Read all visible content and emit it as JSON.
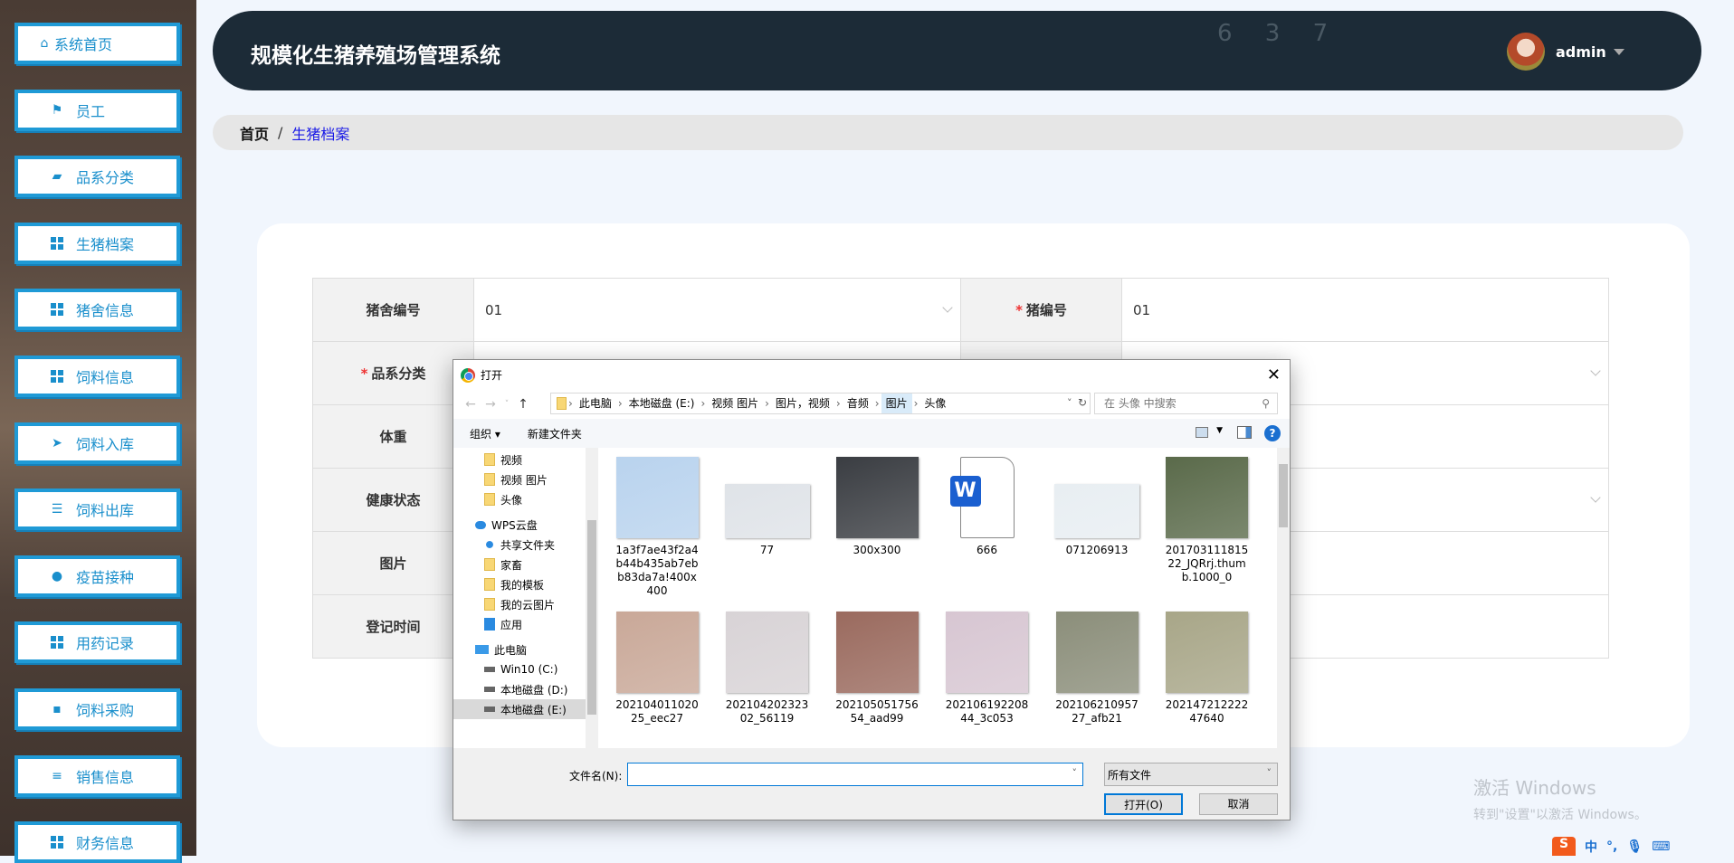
{
  "sidebar": {
    "items": [
      {
        "label": "系统首页",
        "icon": "home-icon"
      },
      {
        "label": "员工",
        "icon": "flag-icon"
      },
      {
        "label": "品系分类",
        "icon": "wallet-icon"
      },
      {
        "label": "生猪档案",
        "icon": "grid-icon"
      },
      {
        "label": "猪舍信息",
        "icon": "grid-icon"
      },
      {
        "label": "饲料信息",
        "icon": "grid-icon"
      },
      {
        "label": "饲料入库",
        "icon": "paper-plane-icon"
      },
      {
        "label": "饲料出库",
        "icon": "sliders-icon"
      },
      {
        "label": "疫苗接种",
        "icon": "bulb-icon"
      },
      {
        "label": "用药记录",
        "icon": "grid-icon"
      },
      {
        "label": "饲料采购",
        "icon": "chat-icon"
      },
      {
        "label": "销售信息",
        "icon": "list-icon"
      },
      {
        "label": "财务信息",
        "icon": "grid-icon"
      }
    ]
  },
  "header": {
    "title": "规模化生猪养殖场管理系统",
    "deco": "6 3 7",
    "user": "admin"
  },
  "breadcrumb": {
    "home": "首页",
    "sep": "/",
    "current": "生猪档案"
  },
  "form": {
    "row1": {
      "label": "猪舍编号",
      "value": "01",
      "label2": "猪编号",
      "value2": "01"
    },
    "row2": {
      "label": "品系分类"
    },
    "row3": {
      "label": "体重"
    },
    "row4": {
      "label": "健康状态"
    },
    "row5": {
      "label": "图片"
    },
    "row6": {
      "label": "登记时间"
    }
  },
  "dialog": {
    "title": "打开",
    "close": "✕",
    "path": [
      "此电脑",
      "本地磁盘 (E:)",
      "视频 图片",
      "图片，视频",
      "音频",
      "图片",
      "头像"
    ],
    "search_placeholder": "在 头像 中搜索",
    "organize": "组织 ▾",
    "new_folder": "新建文件夹",
    "nav": [
      {
        "label": "视频",
        "type": "folder"
      },
      {
        "label": "视频 图片",
        "type": "folder"
      },
      {
        "label": "头像",
        "type": "folder"
      },
      {
        "label": "WPS云盘",
        "type": "cloud"
      },
      {
        "label": "共享文件夹",
        "type": "share"
      },
      {
        "label": "家畜",
        "type": "folder"
      },
      {
        "label": "我的模板",
        "type": "folder"
      },
      {
        "label": "我的云图片",
        "type": "folder"
      },
      {
        "label": "应用",
        "type": "apps"
      },
      {
        "label": "此电脑",
        "type": "pc"
      },
      {
        "label": "Win10 (C:)",
        "type": "drive"
      },
      {
        "label": "本地磁盘 (D:)",
        "type": "drive"
      },
      {
        "label": "本地磁盘 (E:)",
        "type": "drive"
      }
    ],
    "files": [
      {
        "name": "1a3f7ae43f2a4b44b435ab7ebb83da7a!400x400",
        "color": "#b9d3ee"
      },
      {
        "name": "77",
        "color": "#dfe3e8"
      },
      {
        "name": "300x300",
        "color": "#3a3d42"
      },
      {
        "name": "666",
        "color": "word"
      },
      {
        "name": "071206913",
        "color": "#e8eef2"
      },
      {
        "name": "20170311181522_JQRrj.thumb.1000_0",
        "color": "#5a6a4a"
      },
      {
        "name": "20210401102025_eec27",
        "color": "#c9a898"
      },
      {
        "name": "20210420232302_56119",
        "color": "#d8d3d6"
      },
      {
        "name": "20210505175654_aad99",
        "color": "#9a6a5e"
      },
      {
        "name": "20210619220844_3c053",
        "color": "#d7c6d2"
      },
      {
        "name": "20210621095727_afb21",
        "color": "#8b8e7a"
      },
      {
        "name": "20214721222247640",
        "color": "#a8a688"
      },
      {
        "name": "",
        "color": "#6a4a3a"
      },
      {
        "name": "",
        "color": "#7a8aa8"
      },
      {
        "name": "",
        "color": "#9ab8c8"
      },
      {
        "name": "",
        "color": "#c8b0a0"
      },
      {
        "name": "",
        "color": "#b8c0c8"
      },
      {
        "name": "",
        "color": "#5a2a2a"
      }
    ],
    "filename_label": "文件名(N):",
    "filename_value": "",
    "filetype": "所有文件",
    "open": "打开(O)",
    "cancel": "取消"
  },
  "watermark": {
    "line1": "激活 Windows",
    "line2": "转到\"设置\"以激活 Windows。"
  },
  "tray": {
    "ime": "S",
    "lang": "中",
    "punct": "°,"
  }
}
